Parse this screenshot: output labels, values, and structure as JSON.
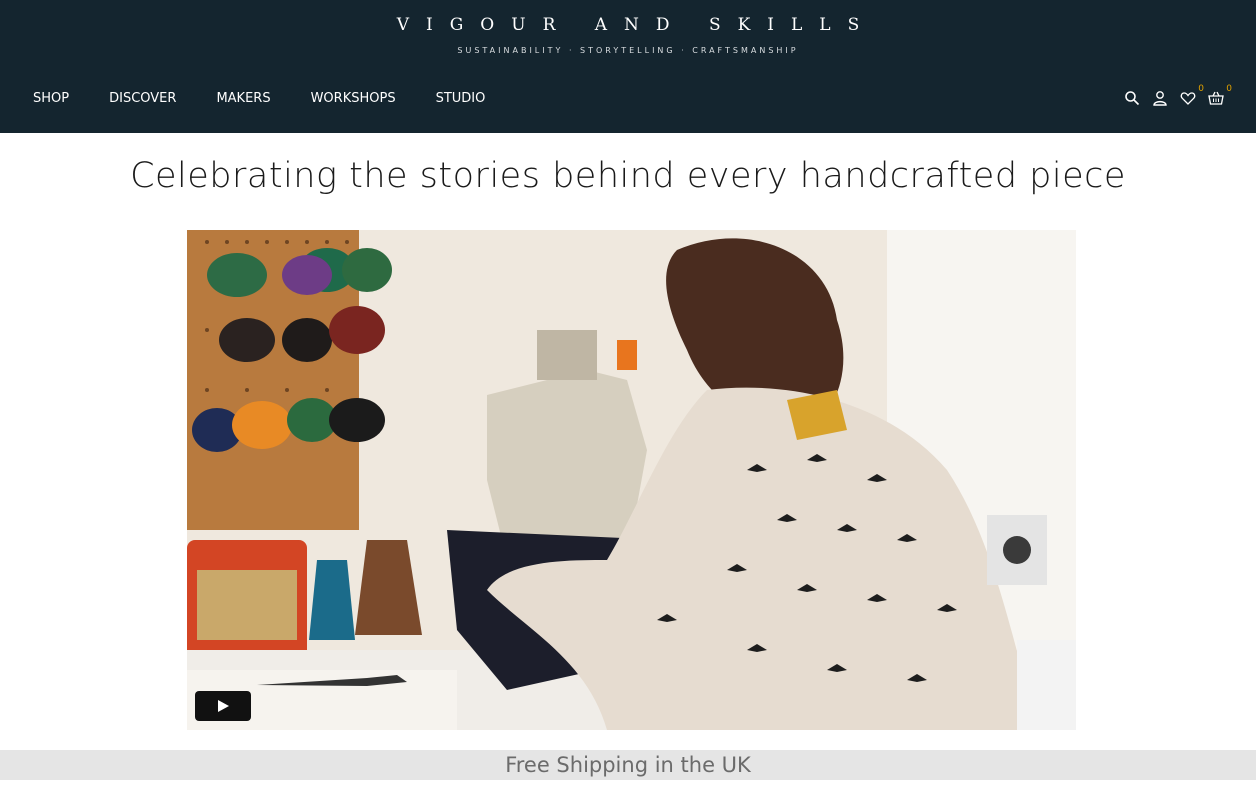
{
  "brand": {
    "name": "VIGOUR AND SKILLS",
    "tagline": "SUSTAINABILITY · STORYTELLING · CRAFTSMANSHIP"
  },
  "nav": {
    "items": [
      {
        "label": "SHOP"
      },
      {
        "label": "DISCOVER"
      },
      {
        "label": "MAKERS"
      },
      {
        "label": "WORKSHOPS"
      },
      {
        "label": "STUDIO"
      }
    ]
  },
  "tools": {
    "wishlist_count": "0",
    "cart_count": "0",
    "icons": [
      "search-icon",
      "user-icon",
      "heart-icon",
      "basket-icon"
    ]
  },
  "main": {
    "headline": "Celebrating the stories behind every handcrafted piece"
  },
  "banner": {
    "text": "Free Shipping in the UK"
  },
  "colors": {
    "header_bg": "#14252f",
    "badge": "#e0a100",
    "banner_bg": "#e5e5e5"
  }
}
